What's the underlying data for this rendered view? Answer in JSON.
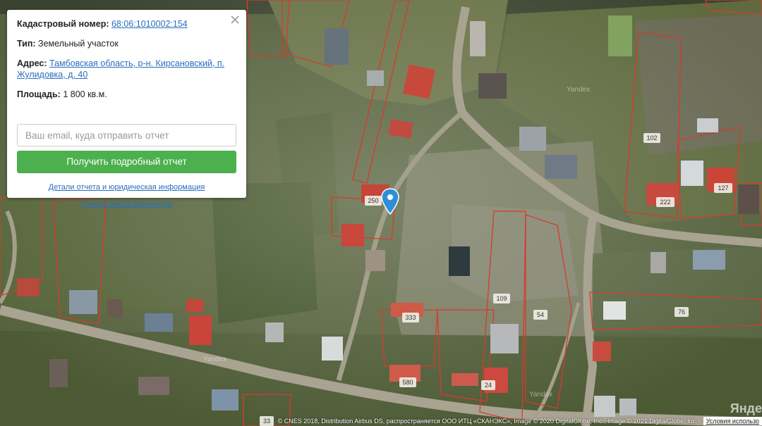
{
  "popup": {
    "cadastral_label": "Кадастровый номер:",
    "cadastral_value": "68:06:1010002:154",
    "type_label": "Тип:",
    "type_value": "Земельный участок",
    "address_label": "Адрес:",
    "address_value": "Тамбовская область, р-н. Кирсановский, п. Жулидовка, д. 40",
    "area_label": "Площадь:",
    "area_value": "1 800 кв.м.",
    "email_placeholder": "Ваш email, куда отправить отчет",
    "report_button": "Получить подробный отчет",
    "details_link": "Детали отчета и юридическая информация",
    "manual_link": "Ручной выбор вариантов"
  },
  "map": {
    "parcel_labels": [
      "102",
      "127",
      "222",
      "250",
      "109",
      "54",
      "76",
      "333",
      "580",
      "33",
      "24"
    ],
    "watermarks": [
      "Yandex",
      "Yandex",
      "Yandex"
    ],
    "attribution": "© CNES 2018, Distribution Airbus DS, распространяется ООО ИТЦ «СКАНЭКС», Image © 2020 DigitalGlobe, Inc., Image © 2021 DigitalGlobe, Inc.",
    "terms": "Условия использо",
    "corner_logo": "Янде",
    "colors": {
      "boundary": "#d83a2e",
      "marker": "#2f8fd6",
      "button": "#4cb04f",
      "link": "#2a6ebd"
    }
  }
}
